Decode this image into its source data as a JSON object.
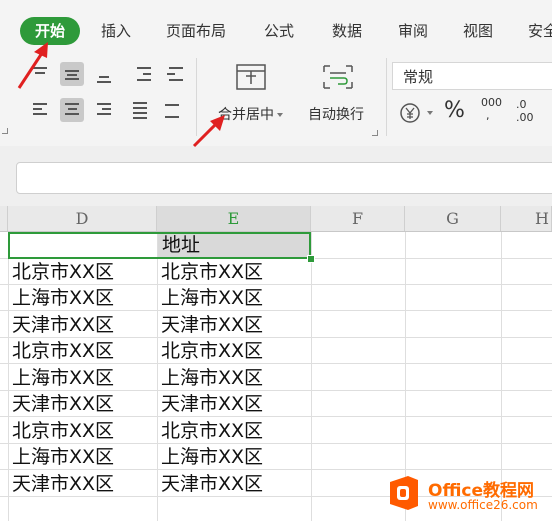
{
  "tabs": [
    {
      "label": "开始",
      "active": true
    },
    {
      "label": "插入"
    },
    {
      "label": "页面布局"
    },
    {
      "label": "公式"
    },
    {
      "label": "数据"
    },
    {
      "label": "审阅"
    },
    {
      "label": "视图"
    },
    {
      "label": "安全"
    }
  ],
  "ribbon": {
    "merge_center": "合并居中",
    "wrap_text": "自动换行",
    "number_format": "常规",
    "percent": "%",
    "thousands": "000",
    "inc_decimal": ".0\n.00",
    "icons": [
      "align-top-icon",
      "align-middle-icon",
      "align-bottom-icon",
      "decrease-indent-icon",
      "increase-indent-icon",
      "align-left-icon",
      "align-center-icon",
      "align-right-icon",
      "justify-icon",
      "distributed-icon",
      "merge-center-icon",
      "wrap-text-icon",
      "currency-icon",
      "percent-icon",
      "thousands-icon",
      "increase-decimal-icon"
    ]
  },
  "columns": [
    "D",
    "E",
    "F",
    "G",
    "H"
  ],
  "selected_column": "E",
  "cells": {
    "e1": "地址",
    "rows": [
      [
        "北京市XX区",
        "北京市XX区"
      ],
      [
        "上海市XX区",
        "上海市XX区"
      ],
      [
        "天津市XX区",
        "天津市XX区"
      ],
      [
        "北京市XX区",
        "北京市XX区"
      ],
      [
        "上海市XX区",
        "上海市XX区"
      ],
      [
        "天津市XX区",
        "天津市XX区"
      ],
      [
        "北京市XX区",
        "北京市XX区"
      ],
      [
        "上海市XX区",
        "上海市XX区"
      ],
      [
        "天津市XX区",
        "天津市XX区"
      ]
    ]
  },
  "colors": {
    "accent": "#2e9a3a",
    "arrow": "#e02020",
    "watermark": "#ff6b00"
  },
  "watermark": {
    "brand": "Office教程网",
    "url": "www.office26.com"
  }
}
